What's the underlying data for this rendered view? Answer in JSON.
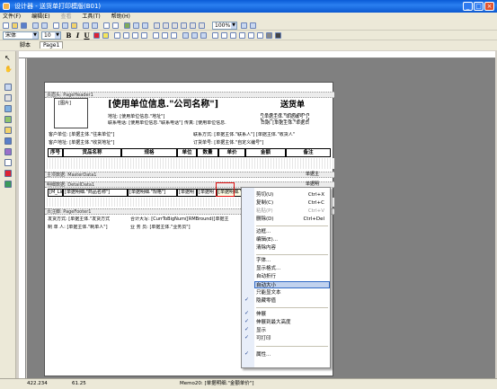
{
  "window": {
    "title": "设计器 - 送货单打印模版(B01)"
  },
  "menu": [
    "文件(F)",
    "编辑(E)",
    "查看",
    "工具(T)",
    "帮助(H)"
  ],
  "toolbar": {
    "font_name": "宋体",
    "font_size": "10",
    "zoom": "100%"
  },
  "tabs": {
    "code": "脚本",
    "page": "Page1"
  },
  "report": {
    "page_header_band": "页眉头: PageHeader1",
    "picture_label": "[图片]",
    "company_title": "[使用单位信息.\"公司名称\"]",
    "doc_title": "送货单",
    "address": "地址: [使用单位信息.\"地址\"]",
    "contact": "联系电话: [使用单位信息.\"联系电话\"] 传真: [使用单位信息.",
    "bill_no": "[单据主体.\"单据编号\"]",
    "date": "日期: [单据主体.\"单据日",
    "customer_unit": "客户单位: [单据主体.\"往来单位\"]",
    "customer_addr": "客户地址: [单据主体.\"收货地址\"]",
    "contact_person": "联系方式: [单据主体.\"联系人\"]  [单据主体.\"收货人\"",
    "order_no": "订货单号: [单据主体.\"自定义编号\"]",
    "headers": [
      "序号",
      "货品名称",
      "规格",
      "单位",
      "数量",
      "单价",
      "金额",
      "备注"
    ],
    "master_band": "主项数据: MasterData1",
    "master_right": "单据主",
    "detail_band": "明细数据: DetailData1",
    "detail_right": "单据明",
    "detail_cells": [
      "[M_Lin",
      "[单据明细.\"商品名称\"]",
      "[单据明细.\"规格\"]",
      "[单据明",
      "[单据明",
      "[单据明细.\"金额\""
    ],
    "footer_band": "页注脚: PageFooter1",
    "delivery_method": "发货方式: [单据主体.\"发货方式",
    "amount_caps": "合计大写: [CurrToBigNum([RMBround([单据主",
    "maker": "制 单 人: [单据主体.\"制单人\"]",
    "salesman": "业 务 员: [单据主体.\"业务员\"]"
  },
  "context_menu": {
    "cut": "剪切(U)",
    "cut_sc": "Ctrl+X",
    "copy": "复制(C)",
    "copy_sc": "Ctrl+C",
    "paste": "粘贴(P)",
    "paste_sc": "Ctrl+V",
    "delete": "删除(D)",
    "delete_sc": "Ctrl+Del",
    "border": "边框...",
    "edit": "编辑(E)...",
    "clear": "清除内容",
    "font": "字体...",
    "display_format": "显示格式...",
    "auto_wrap": "自动折行",
    "auto_size": "自动大小",
    "word_wrap_text": "只能显文本",
    "hide_zero": "隐藏零值",
    "stretch": "伸展",
    "stretch_max": "伸展到最大高度",
    "visible": "显示",
    "printable": "可打印",
    "properties": "属性..."
  },
  "status": {
    "pos": "422.234",
    "size": "61.25",
    "object": "Memo20: [单据明细.\"金额单价\"]"
  }
}
